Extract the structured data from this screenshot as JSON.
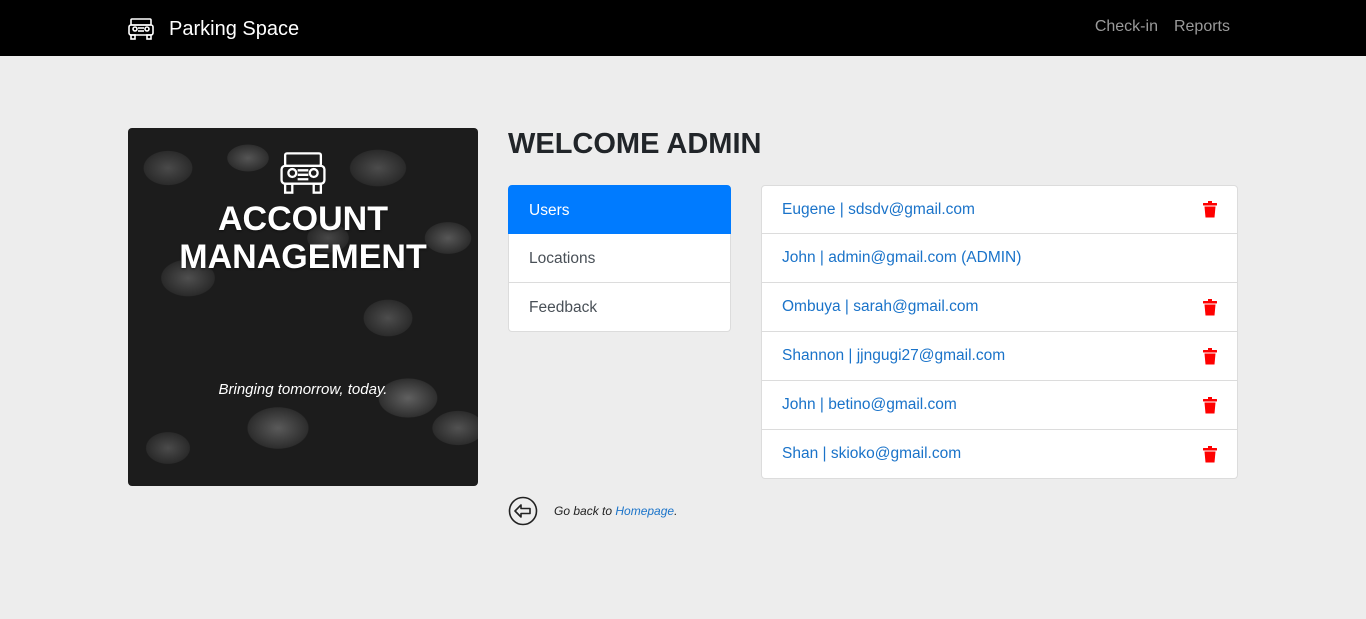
{
  "navbar": {
    "brand_icon": "jeep-icon",
    "brand": "Parking Space",
    "links": [
      "Check-in",
      "Reports"
    ]
  },
  "hero": {
    "icon": "jeep-icon",
    "title_line1": "ACCOUNT",
    "title_line2": "MANAGEMENT",
    "tagline": "Bringing tomorrow, today."
  },
  "main": {
    "heading": "WELCOME ADMIN",
    "tabs": [
      {
        "label": "Users",
        "active": true
      },
      {
        "label": "Locations",
        "active": false
      },
      {
        "label": "Feedback",
        "active": false
      }
    ],
    "users": [
      {
        "label": "Eugene | sdsdv@gmail.com",
        "deletable": true
      },
      {
        "label": "John | admin@gmail.com (ADMIN)",
        "deletable": false
      },
      {
        "label": "Ombuya | sarah@gmail.com",
        "deletable": true
      },
      {
        "label": "Shannon | jjngugi27@gmail.com",
        "deletable": true
      },
      {
        "label": "John | betino@gmail.com",
        "deletable": true
      },
      {
        "label": "Shan | skioko@gmail.com",
        "deletable": true
      }
    ],
    "delete_icon": "trash-icon",
    "delete_color": "#ff0000"
  },
  "footer_nav": {
    "back_icon": "arrow-left-circle-icon",
    "prefix": "Go back to ",
    "link": "Homepage",
    "suffix": "."
  },
  "colors": {
    "navbar_bg": "#000000",
    "page_bg": "#ededed",
    "active_tab": "#007bff",
    "link": "#1a73c9"
  }
}
